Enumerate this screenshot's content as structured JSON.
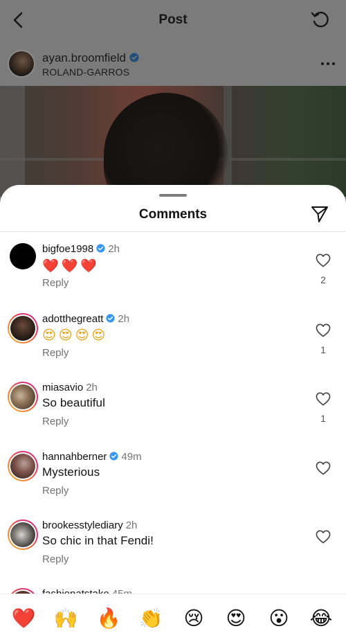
{
  "app": {
    "screen_title": "Post",
    "colors": {
      "accent_verified": "#3897f0",
      "like_red": "#ed4956",
      "sheet_bg": "#ffffff",
      "dim_overlay": "#7b7b7b"
    }
  },
  "post": {
    "username": "ayan.broomfield",
    "location": "ROLAND-GARROS",
    "verified": true
  },
  "comments_sheet": {
    "title": "Comments",
    "items": [
      {
        "username": "bigfoe1998",
        "verified": true,
        "time": "2h",
        "text": "❤️❤️❤️",
        "reply": "Reply",
        "likes": "2"
      },
      {
        "username": "adotthegreatt",
        "verified": true,
        "time": "2h",
        "text": "😍😍😍😍",
        "reply": "Reply",
        "likes": "1"
      },
      {
        "username": "miasavio",
        "verified": false,
        "time": "2h",
        "text": "So beautiful",
        "reply": "Reply",
        "likes": "1"
      },
      {
        "username": "hannahberner",
        "verified": true,
        "time": "49m",
        "text": "Mysterious",
        "reply": "Reply",
        "likes": ""
      },
      {
        "username": "brookesstylediary",
        "verified": false,
        "time": "2h",
        "text": "So chic in that Fendi!",
        "reply": "Reply",
        "likes": ""
      },
      {
        "username": "fashionatstake",
        "verified": false,
        "time": "45m",
        "text": "",
        "reply": "",
        "likes": ""
      }
    ]
  },
  "emoji_bar": [
    "❤️",
    "🙌",
    "🔥",
    "👏",
    "😢",
    "😍",
    "😮",
    "😂"
  ]
}
